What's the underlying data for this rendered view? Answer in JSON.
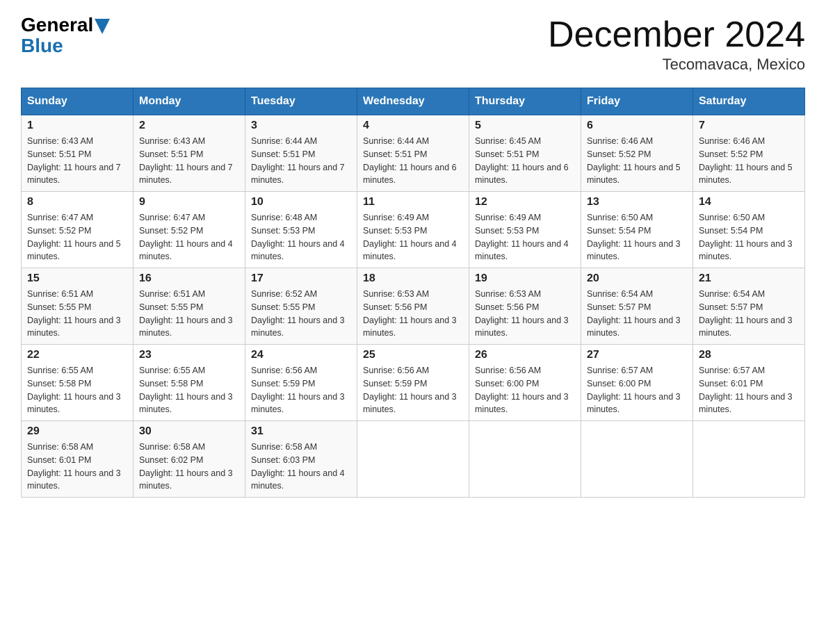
{
  "header": {
    "logo_general": "General",
    "logo_blue": "Blue",
    "month_title": "December 2024",
    "location": "Tecomavaca, Mexico"
  },
  "days_of_week": [
    "Sunday",
    "Monday",
    "Tuesday",
    "Wednesday",
    "Thursday",
    "Friday",
    "Saturday"
  ],
  "weeks": [
    [
      {
        "day": "1",
        "sunrise": "6:43 AM",
        "sunset": "5:51 PM",
        "daylight": "11 hours and 7 minutes."
      },
      {
        "day": "2",
        "sunrise": "6:43 AM",
        "sunset": "5:51 PM",
        "daylight": "11 hours and 7 minutes."
      },
      {
        "day": "3",
        "sunrise": "6:44 AM",
        "sunset": "5:51 PM",
        "daylight": "11 hours and 7 minutes."
      },
      {
        "day": "4",
        "sunrise": "6:44 AM",
        "sunset": "5:51 PM",
        "daylight": "11 hours and 6 minutes."
      },
      {
        "day": "5",
        "sunrise": "6:45 AM",
        "sunset": "5:51 PM",
        "daylight": "11 hours and 6 minutes."
      },
      {
        "day": "6",
        "sunrise": "6:46 AM",
        "sunset": "5:52 PM",
        "daylight": "11 hours and 5 minutes."
      },
      {
        "day": "7",
        "sunrise": "6:46 AM",
        "sunset": "5:52 PM",
        "daylight": "11 hours and 5 minutes."
      }
    ],
    [
      {
        "day": "8",
        "sunrise": "6:47 AM",
        "sunset": "5:52 PM",
        "daylight": "11 hours and 5 minutes."
      },
      {
        "day": "9",
        "sunrise": "6:47 AM",
        "sunset": "5:52 PM",
        "daylight": "11 hours and 4 minutes."
      },
      {
        "day": "10",
        "sunrise": "6:48 AM",
        "sunset": "5:53 PM",
        "daylight": "11 hours and 4 minutes."
      },
      {
        "day": "11",
        "sunrise": "6:49 AM",
        "sunset": "5:53 PM",
        "daylight": "11 hours and 4 minutes."
      },
      {
        "day": "12",
        "sunrise": "6:49 AM",
        "sunset": "5:53 PM",
        "daylight": "11 hours and 4 minutes."
      },
      {
        "day": "13",
        "sunrise": "6:50 AM",
        "sunset": "5:54 PM",
        "daylight": "11 hours and 3 minutes."
      },
      {
        "day": "14",
        "sunrise": "6:50 AM",
        "sunset": "5:54 PM",
        "daylight": "11 hours and 3 minutes."
      }
    ],
    [
      {
        "day": "15",
        "sunrise": "6:51 AM",
        "sunset": "5:55 PM",
        "daylight": "11 hours and 3 minutes."
      },
      {
        "day": "16",
        "sunrise": "6:51 AM",
        "sunset": "5:55 PM",
        "daylight": "11 hours and 3 minutes."
      },
      {
        "day": "17",
        "sunrise": "6:52 AM",
        "sunset": "5:55 PM",
        "daylight": "11 hours and 3 minutes."
      },
      {
        "day": "18",
        "sunrise": "6:53 AM",
        "sunset": "5:56 PM",
        "daylight": "11 hours and 3 minutes."
      },
      {
        "day": "19",
        "sunrise": "6:53 AM",
        "sunset": "5:56 PM",
        "daylight": "11 hours and 3 minutes."
      },
      {
        "day": "20",
        "sunrise": "6:54 AM",
        "sunset": "5:57 PM",
        "daylight": "11 hours and 3 minutes."
      },
      {
        "day": "21",
        "sunrise": "6:54 AM",
        "sunset": "5:57 PM",
        "daylight": "11 hours and 3 minutes."
      }
    ],
    [
      {
        "day": "22",
        "sunrise": "6:55 AM",
        "sunset": "5:58 PM",
        "daylight": "11 hours and 3 minutes."
      },
      {
        "day": "23",
        "sunrise": "6:55 AM",
        "sunset": "5:58 PM",
        "daylight": "11 hours and 3 minutes."
      },
      {
        "day": "24",
        "sunrise": "6:56 AM",
        "sunset": "5:59 PM",
        "daylight": "11 hours and 3 minutes."
      },
      {
        "day": "25",
        "sunrise": "6:56 AM",
        "sunset": "5:59 PM",
        "daylight": "11 hours and 3 minutes."
      },
      {
        "day": "26",
        "sunrise": "6:56 AM",
        "sunset": "6:00 PM",
        "daylight": "11 hours and 3 minutes."
      },
      {
        "day": "27",
        "sunrise": "6:57 AM",
        "sunset": "6:00 PM",
        "daylight": "11 hours and 3 minutes."
      },
      {
        "day": "28",
        "sunrise": "6:57 AM",
        "sunset": "6:01 PM",
        "daylight": "11 hours and 3 minutes."
      }
    ],
    [
      {
        "day": "29",
        "sunrise": "6:58 AM",
        "sunset": "6:01 PM",
        "daylight": "11 hours and 3 minutes."
      },
      {
        "day": "30",
        "sunrise": "6:58 AM",
        "sunset": "6:02 PM",
        "daylight": "11 hours and 3 minutes."
      },
      {
        "day": "31",
        "sunrise": "6:58 AM",
        "sunset": "6:03 PM",
        "daylight": "11 hours and 4 minutes."
      },
      null,
      null,
      null,
      null
    ]
  ]
}
